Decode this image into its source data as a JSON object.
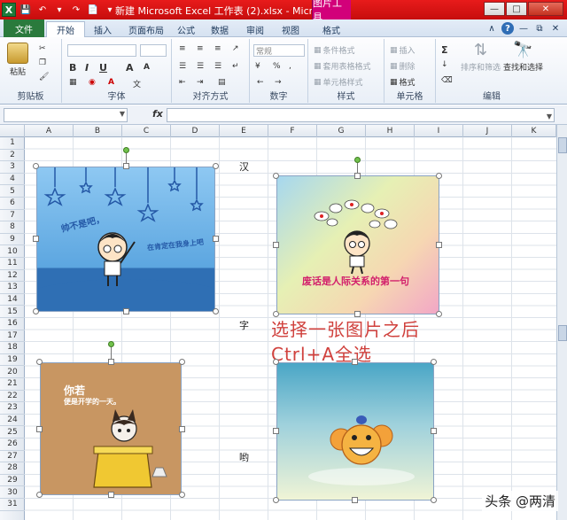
{
  "titlebar": {
    "title": "新建 Microsoft Excel 工作表 (2).xlsx - Microso...",
    "picture_tools": "图片工具",
    "app_icon": "X"
  },
  "tabs": [
    "文件",
    "开始",
    "插入",
    "页面布局",
    "公式",
    "数据",
    "审阅",
    "视图",
    "格式"
  ],
  "ribbon": {
    "clipboard": {
      "paste": "粘贴",
      "label": "剪贴板"
    },
    "font": {
      "label": "字体",
      "bold": "B",
      "italic": "I",
      "underline": "U",
      "grow": "A",
      "shrink": "A"
    },
    "alignment": {
      "label": "对齐方式"
    },
    "number": {
      "label": "数字",
      "format": "常规",
      "percent": "%"
    },
    "styles": {
      "label": "样式",
      "conditional": "条件格式",
      "table": "套用表格格式",
      "cell": "单元格样式"
    },
    "cells": {
      "label": "单元格",
      "insert": "插入",
      "delete": "删除",
      "format": "格式"
    },
    "editing": {
      "label": "编辑",
      "sort": "排序和筛选",
      "find": "查找和选择",
      "sum": "Σ"
    }
  },
  "formula_bar": {
    "fx": "fx"
  },
  "columns": [
    "A",
    "B",
    "C",
    "D",
    "E",
    "F",
    "G",
    "H",
    "I",
    "J",
    "K"
  ],
  "rows": [
    "1",
    "2",
    "3",
    "4",
    "5",
    "6",
    "7",
    "8",
    "9",
    "10",
    "11",
    "12",
    "13",
    "14",
    "15",
    "16",
    "17",
    "18",
    "19",
    "20",
    "21",
    "22",
    "23",
    "24",
    "25",
    "26",
    "27",
    "28",
    "29",
    "30",
    "31"
  ],
  "cells": {
    "e3": "汉",
    "e16": "字",
    "e27": "哟"
  },
  "pictures": {
    "p1_caption": "帅不是吧，",
    "p1_caption2": "在肯定在我身上吧",
    "p2_caption": "废话是人际关系的第一句",
    "p3_caption": "你若",
    "p3_caption2": "便是开学的一天。"
  },
  "overlay": {
    "line1": "选择一张图片之后",
    "line2": "Ctrl+A全选"
  },
  "watermark": "头条 @两清",
  "colors": {
    "title_red": "#e81b1b",
    "picture_tools": "#d2007a",
    "file_tab": "#2a7a3c",
    "annotation": "#d0413d"
  }
}
